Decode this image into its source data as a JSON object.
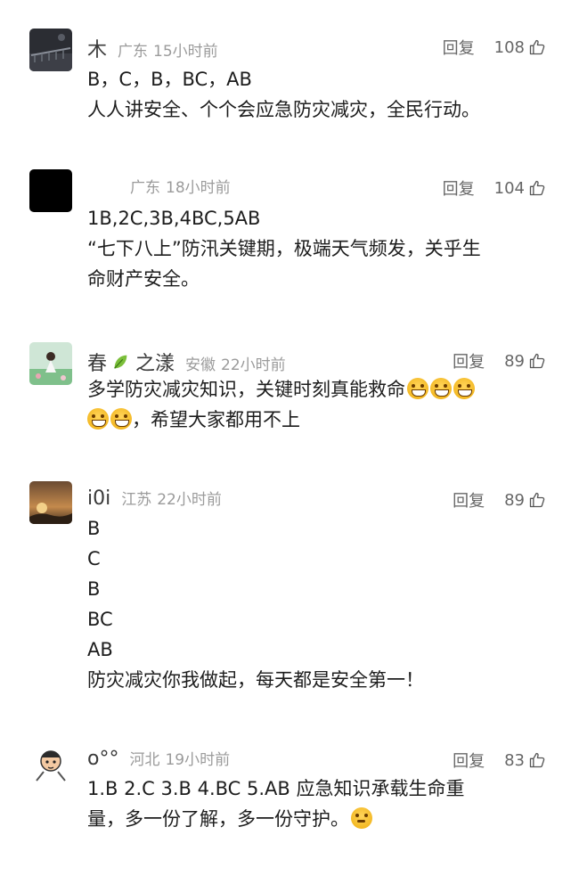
{
  "comments": [
    {
      "username": "木",
      "location": "广东",
      "time": "15小时前",
      "reply": "回复",
      "likes": "108",
      "lines": [
        "B，C，B，BC，AB",
        "人人讲安全、个个会应急防灾减灾，全民行动。"
      ]
    },
    {
      "username": "",
      "location": "广东",
      "time": "18小时前",
      "reply": "回复",
      "likes": "104",
      "lines": [
        "1B,2C,3B,4BC,5AB",
        "“七下八上”防汛关键期，极端天气频发，关乎生",
        "命财产安全。"
      ]
    },
    {
      "username": "春",
      "username_suffix": "之漾",
      "location": "安徽",
      "time": "22小时前",
      "reply": "回复",
      "likes": "89",
      "lines": [
        "多学防灾减灾知识，关键时刻真能救命",
        "，希望大家都用不上"
      ]
    },
    {
      "username": "i0i",
      "location": "江苏",
      "time": "22小时前",
      "reply": "回复",
      "likes": "89",
      "lines": [
        "B",
        "C",
        "B",
        "BC",
        "AB",
        "防灾减灾你我做起，每天都是安全第一！"
      ]
    },
    {
      "username": "o°°",
      "location": "河北",
      "time": "19小时前",
      "reply": "回复",
      "likes": "83",
      "lines": [
        "1.B 2.C 3.B 4.BC 5.AB 应急知识承载生命重",
        "量，多一份了解，多一份守护。"
      ]
    }
  ],
  "icons": {
    "like": "thumb-up-outline-icon",
    "emoji_grin": "grinning-face-icon",
    "emoji_think": "thinking-face-icon",
    "leaf": "leaf-icon"
  },
  "colors": {
    "meta": "#9b9b9b",
    "text": "#1d1d1d",
    "action": "#666666"
  }
}
